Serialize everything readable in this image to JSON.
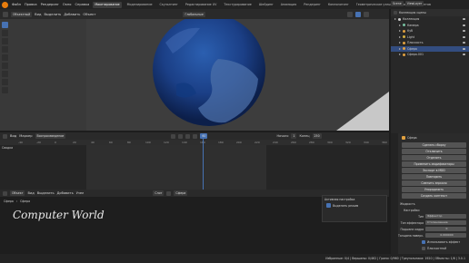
{
  "menu": [
    "Файл",
    "Правка",
    "Рендеринг",
    "Окно",
    "Справка"
  ],
  "workspaces": [
    "Макетирование",
    "Моделирование",
    "Скульптинг",
    "Редактирование UV",
    "Текстурирование",
    "Шейдинг",
    "Анимация",
    "Рендеринг",
    "Композитинг",
    "Геометрические узлы",
    "Написание скриптов"
  ],
  "active_workspace": "Макетирование",
  "top_right": {
    "scene": "Scene",
    "view_layer": "ViewLayer"
  },
  "viewport_header": {
    "mode": "Объектный",
    "view": "Вид",
    "select": "Выделить",
    "add": "Добавить",
    "object": "Объект",
    "transform": "Глобальные"
  },
  "outliner": {
    "title": "Коллекция сцены",
    "rows": [
      {
        "label": "Коллекция",
        "indent": 0,
        "color": "#cfcfcf",
        "selected": false
      },
      {
        "label": "Камера",
        "indent": 1,
        "color": "#76c0a0",
        "selected": false
      },
      {
        "label": "Куб",
        "indent": 1,
        "color": "#e0a040",
        "selected": false
      },
      {
        "label": "Light",
        "indent": 1,
        "color": "#d8b040",
        "selected": false
      },
      {
        "label": "Плоскость",
        "indent": 1,
        "color": "#e0a040",
        "selected": false
      },
      {
        "label": "Сфера",
        "indent": 1,
        "color": "#e0a040",
        "selected": true
      },
      {
        "label": "Сфера.001",
        "indent": 1,
        "color": "#e0a040",
        "selected": false
      }
    ]
  },
  "properties": {
    "tab": "Сфера",
    "buttons": [
      "Сделать сборку",
      "Отключить",
      "Отделить",
      "Применить модификаторы",
      "Экспорт в MDD",
      "Повторить",
      "Сменить зеркало",
      "Упорядочить",
      "Создать контекст"
    ],
    "section": "Жидкость",
    "settings": "Настройки",
    "type_label": "Тип",
    "type_value": "Эффектор",
    "effector_label": "Тип эффектора",
    "effector_value": "Столкновение",
    "subframes_label": "Подшаги кадра",
    "subframes_value": "0",
    "surface_label": "Толщина поверх.",
    "surface_value": "0.000000",
    "use_effector": "Использовать эффект",
    "is_planar": "Плоскостной"
  },
  "timeline": {
    "header": [
      "Вид",
      "Маркер",
      "Воспроизведение"
    ],
    "start_label": "Начало",
    "start": "1",
    "end_label": "Конец",
    "end": "250",
    "current_frame": "60",
    "ticks": [
      "-40",
      "-20",
      "0",
      "20",
      "40",
      "60",
      "80",
      "100",
      "120",
      "140",
      "160",
      "180",
      "200",
      "220",
      "240",
      "260",
      "280",
      "300",
      "320",
      "340",
      "360"
    ],
    "summary": "Сводка",
    "current_frame_fraction": 0.52
  },
  "shader": {
    "header": [
      "Объект",
      "Вид",
      "Выделить",
      "Добавить",
      "Узел"
    ],
    "slot": "Слот",
    "material": "Сфера",
    "breadcrumb": [
      "Сфера",
      "Сфера"
    ],
    "watermark": "Computer World",
    "panel_title": "Активная настройка",
    "panel_item": "Выделить режим"
  },
  "status": {
    "text": "Избранные: 0/4 | Вершины: 0/462 | Грани: 0/960 | Треугольники: 1920 | Объекты: 1/6 | 3.0.1",
    "stats": "3.0.1"
  }
}
